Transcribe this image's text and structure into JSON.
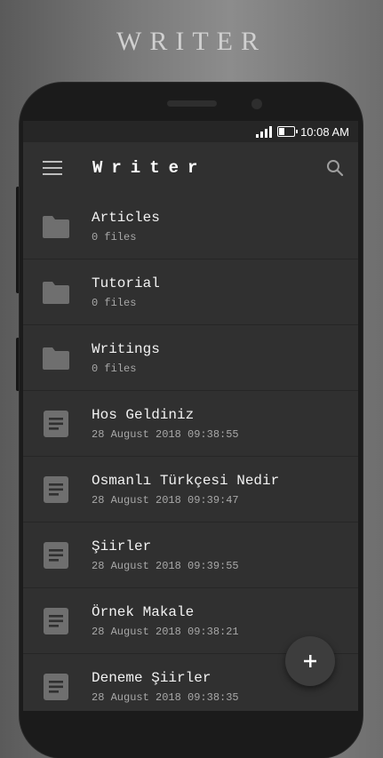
{
  "banner": {
    "text": "WRITER"
  },
  "status": {
    "time": "10:08 AM",
    "signal_icon": "signal-icon",
    "battery_icon": "battery-icon"
  },
  "toolbar": {
    "title": "Writer",
    "menu_icon": "menu-icon",
    "search_icon": "search-icon"
  },
  "items": [
    {
      "type": "folder",
      "name": "Articles",
      "meta": "0 files"
    },
    {
      "type": "folder",
      "name": "Tutorial",
      "meta": "0 files"
    },
    {
      "type": "folder",
      "name": "Writings",
      "meta": "0 files"
    },
    {
      "type": "document",
      "name": "Hos Geldiniz",
      "meta": "28 August 2018 09:38:55"
    },
    {
      "type": "document",
      "name": "Osmanlı Türkçesi Nedir",
      "meta": "28 August 2018 09:39:47"
    },
    {
      "type": "document",
      "name": "Şiirler",
      "meta": "28 August 2018 09:39:55"
    },
    {
      "type": "document",
      "name": "Örnek Makale",
      "meta": "28 August 2018 09:38:21"
    },
    {
      "type": "document",
      "name": "Deneme Şiirler",
      "meta": "28 August 2018 09:38:35"
    }
  ],
  "fab": {
    "icon": "plus-icon"
  },
  "colors": {
    "screen_bg": "#303030",
    "text": "#f2f2f2",
    "meta": "#a8a8a8",
    "icon": "#6f6f6f"
  }
}
